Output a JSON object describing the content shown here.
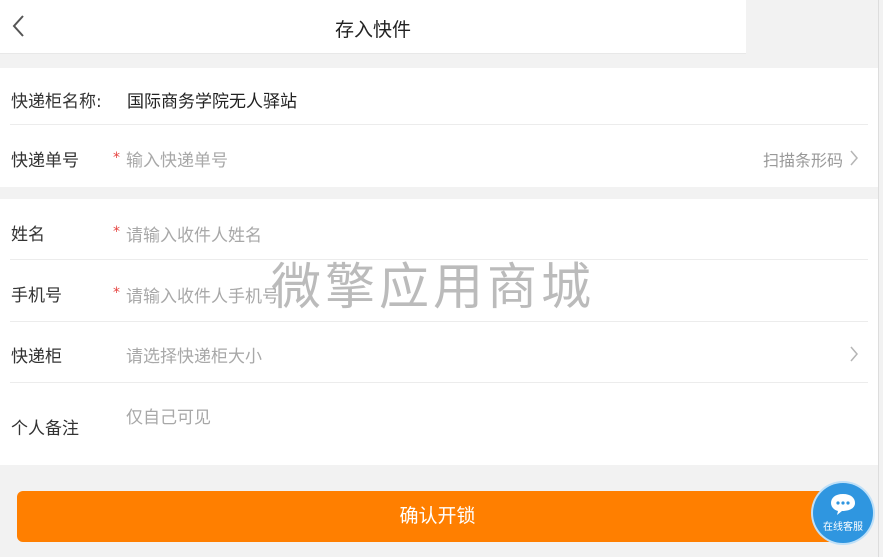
{
  "header": {
    "title": "存入快件",
    "back_icon": "chevron-left-icon"
  },
  "locker": {
    "label": "快递柜名称:",
    "value": "国际商务学院无人驿站"
  },
  "tracking": {
    "label": "快递单号",
    "required": "*",
    "placeholder": "输入快递单号",
    "scan_label": "扫描条形码"
  },
  "name": {
    "label": "姓名",
    "required": "*",
    "placeholder": "请输入收件人姓名"
  },
  "phone": {
    "label": "手机号",
    "required": "*",
    "placeholder": "请输入收件人手机号"
  },
  "cabinet": {
    "label": "快递柜",
    "placeholder": "请选择快递柜大小"
  },
  "remark": {
    "label": "个人备注",
    "placeholder": "仅自己可见"
  },
  "confirm_button": {
    "label": "确认开锁"
  },
  "watermark": {
    "text": "微擎应用商城"
  },
  "support": {
    "label": "在线客服",
    "icon": "chat-bubble-icon"
  },
  "colors": {
    "accent": "#ff7f00",
    "required": "#e64340",
    "support": "#2f96e0"
  }
}
